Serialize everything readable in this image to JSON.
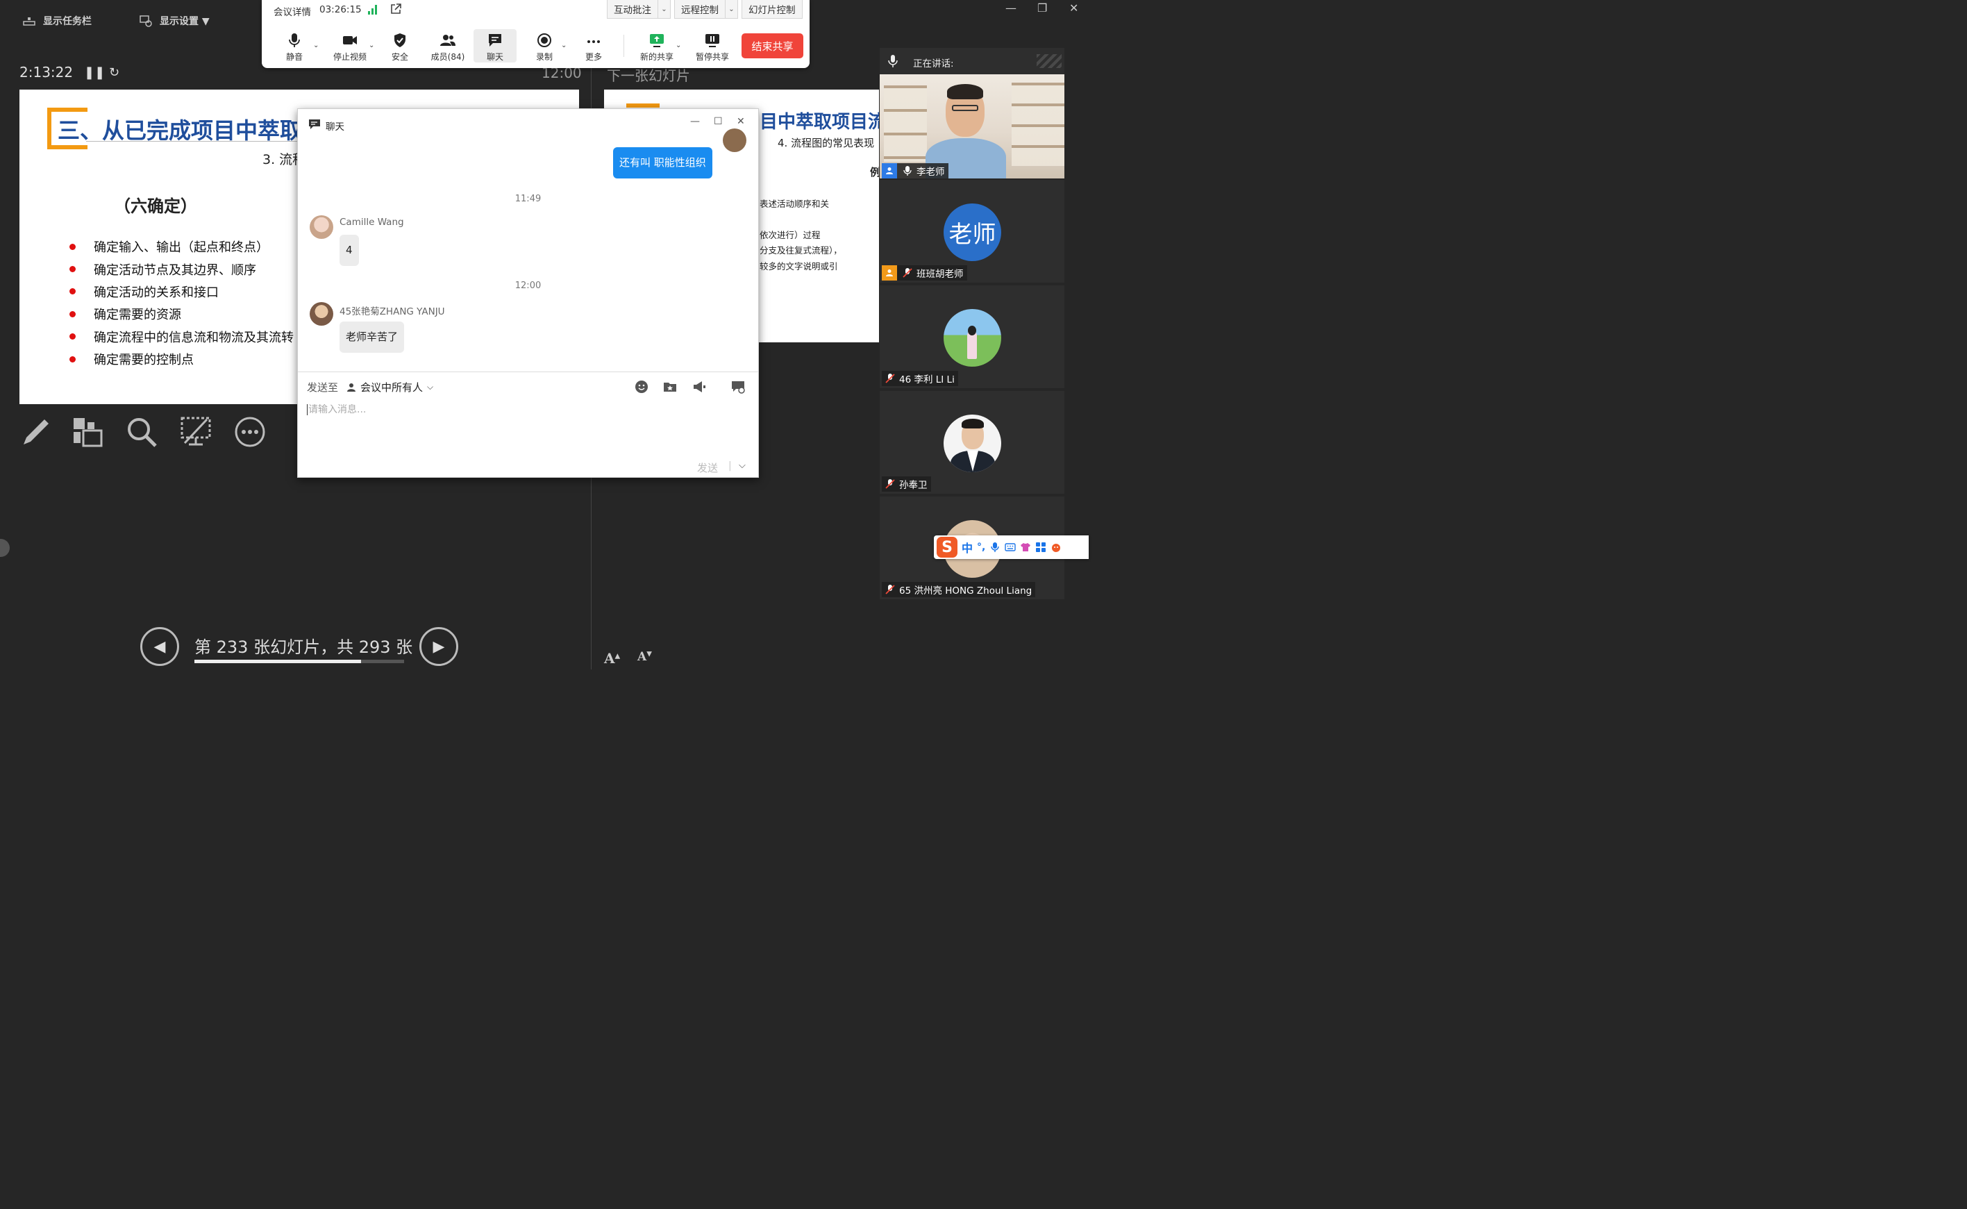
{
  "presenter_bar": {
    "taskbar_label": "显示任务栏",
    "display_settings_label": "显示设置 ▼"
  },
  "presenter": {
    "elapsed": "2:13:22",
    "clock": "12:00",
    "next_label": "下一张幻灯片",
    "slide_counter": "第 233 张幻灯片，共 293 张",
    "progress_fraction": 0.795
  },
  "slide": {
    "title": "三、从已完成项目中萃取",
    "subtitle": "3. 流程",
    "heading": "（六确定）",
    "bullets": [
      "确定输入、输出（起点和终点）",
      "确定活动节点及其边界、顺序",
      "确定活动的关系和接口",
      "确定需要的资源",
      "确定流程中的信息流和物流及其流转",
      "确定需要的控制点"
    ]
  },
  "next_slide": {
    "title": "目中萃取项目流",
    "subtitle": "4. 流程图的常见表现",
    "example": "例",
    "lines": [
      "表述活动顺序和关",
      "依次进行）过程",
      "分支及往复式流程），",
      "较多的文字说明或引"
    ]
  },
  "meeting_toolbar": {
    "info_label": "会议详情",
    "duration": "03:26:15",
    "pills": [
      "互动批注",
      "远程控制",
      "幻灯片控制"
    ],
    "buttons": {
      "mute": "静音",
      "stop_video": "停止视频",
      "security": "安全",
      "members": "成员(84)",
      "chat": "聊天",
      "record": "录制",
      "more": "更多",
      "new_share": "新的共享",
      "pause_share": "暂停共享"
    },
    "end_share": "结束共享"
  },
  "chat": {
    "title": "聊天",
    "messages": [
      {
        "type": "out",
        "text": "还有叫  职能性组织"
      },
      {
        "type": "time",
        "text": "11:49"
      },
      {
        "type": "in",
        "sender": "Camille Wang",
        "text": "4"
      },
      {
        "type": "time",
        "text": "12:00"
      },
      {
        "type": "in",
        "sender": "45张艳菊ZHANG YANJU",
        "text": "老师辛苦了"
      }
    ],
    "send_to_label": "发送至",
    "send_target": "会议中所有人",
    "input_placeholder": "请输入消息...",
    "send_label": "发送"
  },
  "participants": {
    "speaking_label": "正在讲话:",
    "tiles": [
      {
        "name": "李老师"
      },
      {
        "name": "班班胡老师",
        "avatar_text": "老师"
      },
      {
        "name": "46 李利 LI Li"
      },
      {
        "name": "孙奉卫"
      },
      {
        "name": "65 洪州亮 HONG Zhoul Liang"
      }
    ]
  },
  "ime": {
    "mode": "中"
  }
}
